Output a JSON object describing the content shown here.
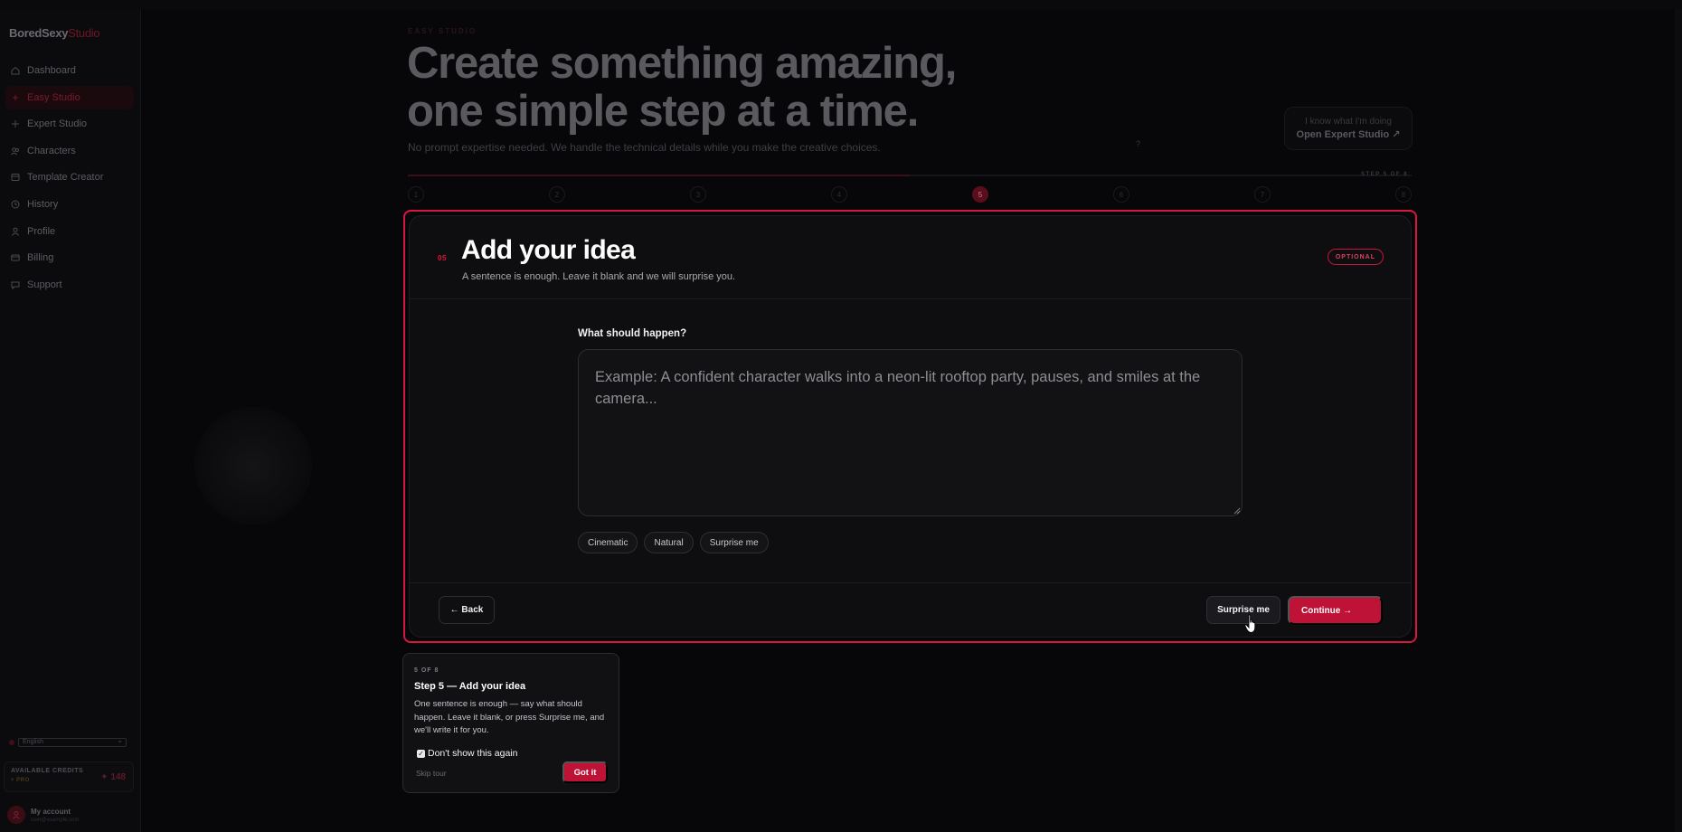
{
  "sidebar": {
    "brand": "BoredSexy",
    "brand_accent": "Studio",
    "items": [
      {
        "label": "Dashboard",
        "icon": "home-icon"
      },
      {
        "label": "Easy Studio",
        "icon": "sparkle-icon",
        "active": true
      },
      {
        "label": "Expert Studio",
        "icon": "plus-icon"
      },
      {
        "label": "Characters",
        "icon": "users-icon"
      },
      {
        "label": "Template Creator",
        "icon": "template-icon"
      },
      {
        "label": "History",
        "icon": "clock-icon"
      },
      {
        "label": "Profile",
        "icon": "user-icon"
      },
      {
        "label": "Billing",
        "icon": "card-icon"
      },
      {
        "label": "Support",
        "icon": "chat-icon"
      }
    ],
    "language": "English",
    "credits": {
      "label": "AVAILABLE CREDITS",
      "plan": "+ PRO",
      "amount": "✦ 148"
    },
    "account": {
      "name": "My account",
      "email": "user@example.com"
    }
  },
  "hero": {
    "kicker": "EASY STUDIO",
    "title_line1": "Create something amazing,",
    "title_line2": "one simple step at a time.",
    "subtitle": "No prompt expertise needed. We handle the technical details while you make the creative choices.",
    "expert_hint": "I know what I'm doing",
    "expert_link": "Open Expert Studio ↗",
    "help": "?"
  },
  "progress": {
    "current_step": 5,
    "total_steps": 8,
    "fraction": 0.5,
    "counter_text": "STEP 5 OF 8",
    "steps": [
      "1",
      "2",
      "3",
      "4",
      "5",
      "6",
      "7",
      "8"
    ]
  },
  "card": {
    "step_no": "05",
    "title": "Add your idea",
    "subtitle": "A sentence is enough. Leave it blank and we will surprise you.",
    "badge": "OPTIONAL",
    "field_label": "What should happen?",
    "field_value": "",
    "field_placeholder": "Example: A confident character walks into a neon-lit rooftop party, pauses, and smiles at the camera...",
    "chips": [
      "Cinematic",
      "Natural",
      "Surprise me"
    ],
    "back": "← Back",
    "surprise": "Surprise me",
    "continue": "Continue →"
  },
  "tour": {
    "count": "5 OF 8",
    "title": "Step 5 — Add your idea",
    "body": "One sentence is enough — say what should happen. Leave it blank, or press Surprise me, and we'll write it for you.",
    "checkbox": "Don't show this again",
    "checked": true,
    "skip": "Skip tour",
    "got_it": "Got it"
  },
  "colors": {
    "accent": "#be1237",
    "highlight": "#d51742",
    "background": "#070709",
    "card": "#0e0e10"
  }
}
